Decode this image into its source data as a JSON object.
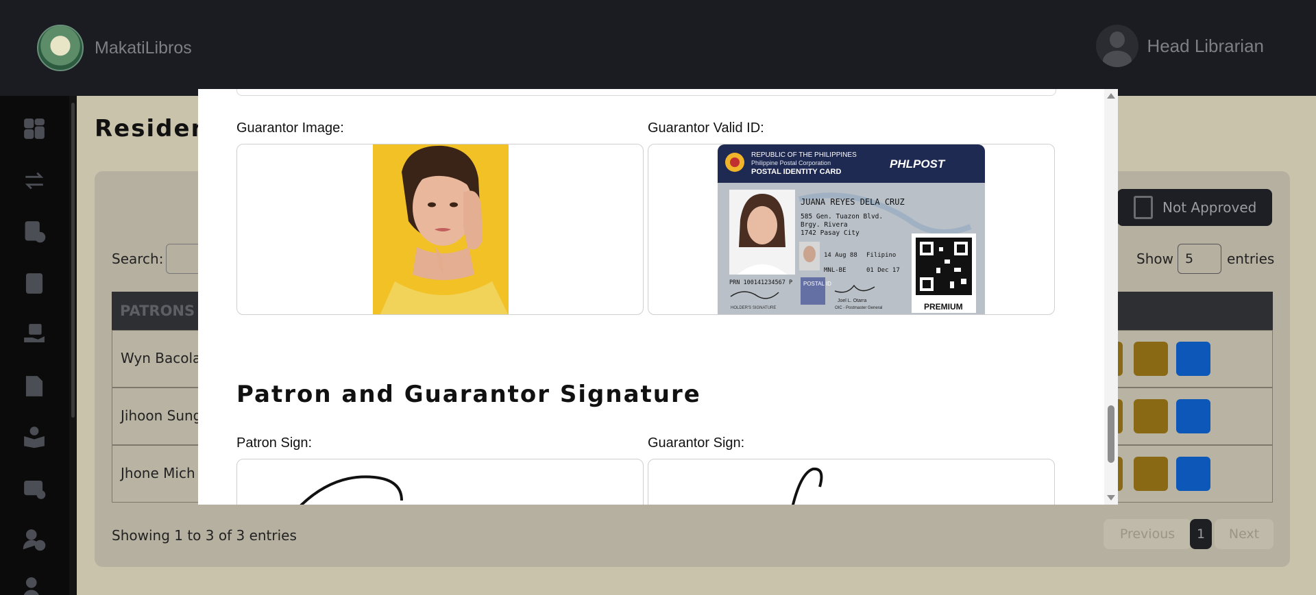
{
  "app": {
    "name": "MakatiLibros"
  },
  "user": {
    "role": "Head Librarian"
  },
  "sidebar": {
    "icons": [
      "dashboard-icon",
      "transactions-icon",
      "approval-list-icon",
      "book-icon",
      "borrow-hand-icon",
      "document-icon",
      "reader-icon",
      "id-card-check-icon",
      "user-ban-icon",
      "user-icon"
    ]
  },
  "background_page": {
    "title": "Residen",
    "not_approved_label": "Not Approved",
    "search_label": "Search:",
    "show_label": "Show",
    "show_value": "5",
    "entries_label": "entries",
    "table_header": "PATRONS",
    "rows": [
      "Wyn Bacola",
      "Jihoon Sung",
      "Jhone Mich"
    ],
    "showing_text": "Showing 1 to 3 of 3 entries",
    "pagination": {
      "previous": "Previous",
      "current": "1",
      "next": "Next"
    }
  },
  "modal": {
    "guarantor_image_label": "Guarantor Image:",
    "guarantor_valid_id_label": "Guarantor Valid ID:",
    "signature_section_title": "Patron and Guarantor Signature",
    "patron_sign_label": "Patron Sign:",
    "guarantor_sign_label": "Guarantor Sign:",
    "id_card": {
      "line1": "REPUBLIC OF THE PHILIPPINES",
      "line2": "Philippine Postal Corporation",
      "line3": "POSTAL IDENTITY CARD",
      "brand": "PHLPOST",
      "name": "JUANA REYES DELA CRUZ",
      "addr1": "585 Gen. Tuazon Blvd.",
      "addr2": "Brgy. Rivera",
      "addr3": "1742 Pasay City",
      "dob": "14 Aug 88",
      "nationality": "Filipino",
      "office": "MNL-BE",
      "valid_until": "01 Dec 17",
      "prn": "PRN 100141234567 P",
      "signatory": "Joel L. Otarra",
      "signatory_title": "OIC - Postmaster General",
      "holder_sig_label": "HOLDER'S SIGNATURE",
      "tier": "PREMIUM",
      "postal_id": "POSTAL ID"
    }
  }
}
